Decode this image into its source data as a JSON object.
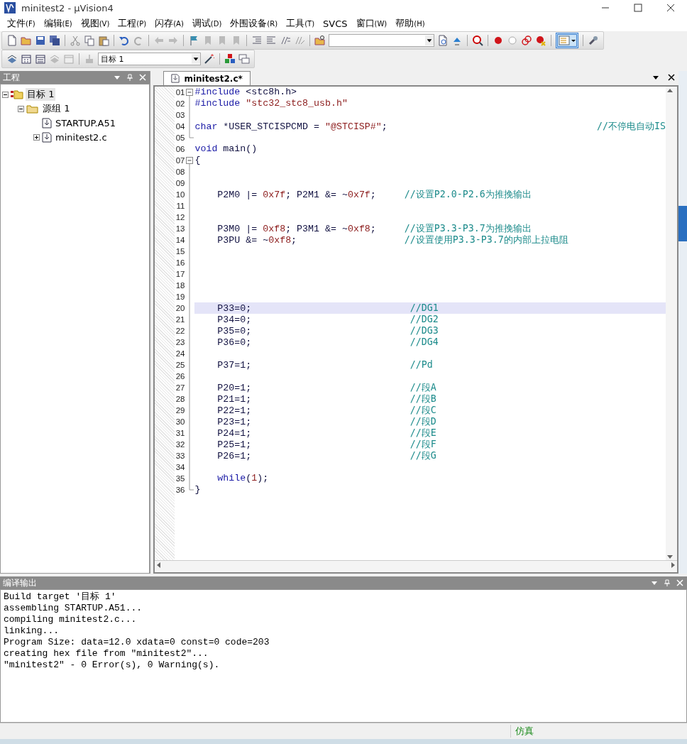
{
  "window": {
    "title": "minitest2  - µVision4"
  },
  "menu": [
    {
      "label": "文件",
      "key": "(F)"
    },
    {
      "label": "编辑",
      "key": "(E)"
    },
    {
      "label": "视图",
      "key": "(V)"
    },
    {
      "label": "工程",
      "key": "(P)"
    },
    {
      "label": "闪存",
      "key": "(A)"
    },
    {
      "label": "调试",
      "key": "(D)"
    },
    {
      "label": "外围设备",
      "key": "(R)"
    },
    {
      "label": "工具",
      "key": "(T)"
    },
    {
      "label": "SVCS"
    },
    {
      "label": "窗口",
      "key": "(W)"
    },
    {
      "label": "帮助",
      "key": "(H)"
    }
  ],
  "target_select": {
    "value": "目标  1"
  },
  "project_panel": {
    "title": "工程",
    "tree": [
      {
        "label": "目标 1",
        "kind": "target",
        "selected": true,
        "expanded": true,
        "children": [
          {
            "label": "源组 1",
            "kind": "group",
            "selected": false,
            "expanded": true,
            "children": [
              {
                "label": "STARTUP.A51",
                "kind": "file",
                "selected": false
              },
              {
                "label": "minitest2.c",
                "kind": "file",
                "selected": false,
                "expanded": false
              }
            ]
          }
        ]
      }
    ]
  },
  "editor": {
    "tabs": [
      {
        "label": "minitest2.c*",
        "selected": true
      }
    ],
    "lines": [
      {
        "no": "01",
        "collapsible": true,
        "current": false,
        "segs": [
          {
            "kind": "keyword",
            "text": "#include"
          },
          {
            "kind": "plain",
            "text": " <stc8h.h>"
          }
        ]
      },
      {
        "no": "02",
        "collapsible": false,
        "current": false,
        "segs": [
          {
            "kind": "keyword",
            "text": "#include"
          },
          {
            "kind": "string",
            "text": " \"stc32_stc8_usb.h\""
          }
        ]
      },
      {
        "no": "03",
        "collapsible": false,
        "current": false
      },
      {
        "no": "04",
        "collapsible": false,
        "current": false,
        "segs": [
          {
            "kind": "keyword",
            "text": "char"
          },
          {
            "kind": "plain",
            "text": " *USER_STCISPCMD = "
          },
          {
            "kind": "string",
            "text": "\"@STCISP#\""
          },
          {
            "kind": "plain",
            "text": ";                                     "
          },
          {
            "kind": "comment",
            "text": "//不停电自动IS"
          }
        ]
      },
      {
        "no": "05",
        "collapsible": false,
        "current": false
      },
      {
        "no": "06",
        "collapsible": false,
        "current": false,
        "segs": [
          {
            "kind": "keyword",
            "text": "void"
          },
          {
            "kind": "plain",
            "text": " main()"
          }
        ]
      },
      {
        "no": "07",
        "collapsible": true,
        "current": false,
        "segs": [
          {
            "kind": "plain",
            "text": "{"
          }
        ]
      },
      {
        "no": "08",
        "collapsible": false,
        "current": false
      },
      {
        "no": "09",
        "collapsible": false,
        "current": false
      },
      {
        "no": "10",
        "collapsible": false,
        "current": false,
        "segs": [
          {
            "kind": "plain",
            "text": "    P2M0 |= "
          },
          {
            "kind": "number",
            "text": "0x7f"
          },
          {
            "kind": "plain",
            "text": "; P2M1 &= ~"
          },
          {
            "kind": "number",
            "text": "0x7f"
          },
          {
            "kind": "plain",
            "text": ";     "
          },
          {
            "kind": "comment",
            "text": "//设置P2.0-P2.6为推挽输出"
          }
        ]
      },
      {
        "no": "11",
        "collapsible": false,
        "current": false
      },
      {
        "no": "12",
        "collapsible": false,
        "current": false
      },
      {
        "no": "13",
        "collapsible": false,
        "current": false,
        "segs": [
          {
            "kind": "plain",
            "text": "    P3M0 |= "
          },
          {
            "kind": "number",
            "text": "0xf8"
          },
          {
            "kind": "plain",
            "text": "; P3M1 &= ~"
          },
          {
            "kind": "number",
            "text": "0xf8"
          },
          {
            "kind": "plain",
            "text": ";     "
          },
          {
            "kind": "comment",
            "text": "//设置P3.3-P3.7为推挽输出"
          }
        ]
      },
      {
        "no": "14",
        "collapsible": false,
        "current": false,
        "segs": [
          {
            "kind": "plain",
            "text": "    P3PU &= ~"
          },
          {
            "kind": "number",
            "text": "0xf8"
          },
          {
            "kind": "plain",
            "text": ";                   "
          },
          {
            "kind": "comment",
            "text": "//设置使用P3.3-P3.7的内部上拉电阻"
          }
        ]
      },
      {
        "no": "15",
        "collapsible": false,
        "current": false
      },
      {
        "no": "16",
        "collapsible": false,
        "current": false
      },
      {
        "no": "17",
        "collapsible": false,
        "current": false
      },
      {
        "no": "18",
        "collapsible": false,
        "current": false
      },
      {
        "no": "19",
        "collapsible": false,
        "current": false
      },
      {
        "no": "20",
        "collapsible": false,
        "current": true,
        "segs": [
          {
            "kind": "plain",
            "text": "    P33=0;                            "
          },
          {
            "kind": "comment",
            "text": "//DG1"
          }
        ]
      },
      {
        "no": "21",
        "collapsible": false,
        "current": false,
        "segs": [
          {
            "kind": "plain",
            "text": "    P34=0;                            "
          },
          {
            "kind": "comment",
            "text": "//DG2"
          }
        ]
      },
      {
        "no": "22",
        "collapsible": false,
        "current": false,
        "segs": [
          {
            "kind": "plain",
            "text": "    P35=0;                            "
          },
          {
            "kind": "comment",
            "text": "//DG3"
          }
        ]
      },
      {
        "no": "23",
        "collapsible": false,
        "current": false,
        "segs": [
          {
            "kind": "plain",
            "text": "    P36=0;                            "
          },
          {
            "kind": "comment",
            "text": "//DG4"
          }
        ]
      },
      {
        "no": "24",
        "collapsible": false,
        "current": false
      },
      {
        "no": "25",
        "collapsible": false,
        "current": false,
        "segs": [
          {
            "kind": "plain",
            "text": "    P37=1;                            "
          },
          {
            "kind": "comment",
            "text": "//Pd"
          }
        ]
      },
      {
        "no": "26",
        "collapsible": false,
        "current": false
      },
      {
        "no": "27",
        "collapsible": false,
        "current": false,
        "segs": [
          {
            "kind": "plain",
            "text": "    P20=1;                            "
          },
          {
            "kind": "comment",
            "text": "//段A"
          }
        ]
      },
      {
        "no": "28",
        "collapsible": false,
        "current": false,
        "segs": [
          {
            "kind": "plain",
            "text": "    P21=1;                            "
          },
          {
            "kind": "comment",
            "text": "//段B"
          }
        ]
      },
      {
        "no": "29",
        "collapsible": false,
        "current": false,
        "segs": [
          {
            "kind": "plain",
            "text": "    P22=1;                            "
          },
          {
            "kind": "comment",
            "text": "//段C"
          }
        ]
      },
      {
        "no": "30",
        "collapsible": false,
        "current": false,
        "segs": [
          {
            "kind": "plain",
            "text": "    P23=1;                            "
          },
          {
            "kind": "comment",
            "text": "//段D"
          }
        ]
      },
      {
        "no": "31",
        "collapsible": false,
        "current": false,
        "segs": [
          {
            "kind": "plain",
            "text": "    P24=1;                            "
          },
          {
            "kind": "comment",
            "text": "//段E"
          }
        ]
      },
      {
        "no": "32",
        "collapsible": false,
        "current": false,
        "segs": [
          {
            "kind": "plain",
            "text": "    P25=1;                            "
          },
          {
            "kind": "comment",
            "text": "//段F"
          }
        ]
      },
      {
        "no": "33",
        "collapsible": false,
        "current": false,
        "segs": [
          {
            "kind": "plain",
            "text": "    P26=1;                            "
          },
          {
            "kind": "comment",
            "text": "//段G"
          }
        ]
      },
      {
        "no": "34",
        "collapsible": false,
        "current": false
      },
      {
        "no": "35",
        "collapsible": false,
        "current": false,
        "segs": [
          {
            "kind": "keyword",
            "text": "    while"
          },
          {
            "kind": "plain",
            "text": "("
          },
          {
            "kind": "number",
            "text": "1"
          },
          {
            "kind": "plain",
            "text": ");"
          }
        ]
      },
      {
        "no": "36",
        "collapsible": false,
        "current": false,
        "segs": [
          {
            "kind": "plain",
            "text": "}"
          }
        ]
      }
    ]
  },
  "output": {
    "title": "编译输出",
    "lines": [
      "Build target '目标 1'",
      "assembling STARTUP.A51...",
      "compiling minitest2.c...",
      "linking...",
      "Program Size: data=12.0 xdata=0 const=0 code=203",
      "creating hex file from \"minitest2\"...",
      "\"minitest2\" - 0 Error(s), 0 Warning(s)."
    ]
  },
  "status_bar": {
    "mode": "仿真"
  }
}
